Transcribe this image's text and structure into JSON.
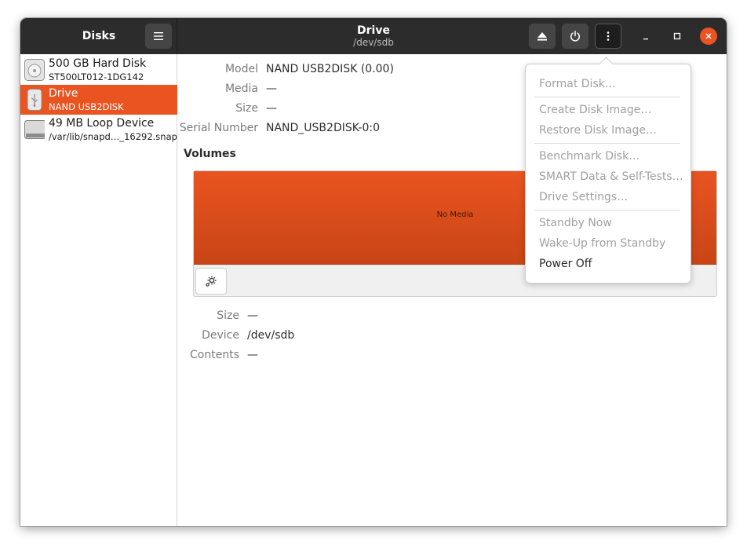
{
  "header": {
    "app_title": "Disks",
    "drive_title": "Drive",
    "drive_subtitle": "/dev/sdb",
    "icons": {
      "menu": "hamburger-icon",
      "eject": "eject-icon",
      "power": "power-icon",
      "more": "vertical-dots-icon",
      "minimize": "minimize-icon",
      "maximize": "maximize-icon",
      "close": "close-icon"
    }
  },
  "sidebar": {
    "items": [
      {
        "name": "500 GB Hard Disk",
        "subtitle": "ST500LT012-1DG142",
        "icon": "hard-disk-icon",
        "selected": false
      },
      {
        "name": "Drive",
        "subtitle": "NAND USB2DISK",
        "icon": "usb-drive-icon",
        "selected": true
      },
      {
        "name": "49 MB Loop Device",
        "subtitle": "/var/lib/snapd…_16292.snap",
        "icon": "loop-device-icon",
        "selected": false
      }
    ]
  },
  "drive_info": {
    "model_label": "Model",
    "model_value": "NAND USB2DISK (0.00)",
    "media_label": "Media",
    "media_value": "—",
    "size_label": "Size",
    "size_value": "—",
    "serial_label": "Serial Number",
    "serial_value": "NAND_USB2DISK-0:0"
  },
  "volumes": {
    "heading": "Volumes",
    "bar_text": "No Media",
    "gear_icon": "gear-icon",
    "size_label": "Size",
    "size_value": "—",
    "device_label": "Device",
    "device_value": "/dev/sdb",
    "contents_label": "Contents",
    "contents_value": "—"
  },
  "menu": {
    "items": [
      {
        "label": "Format Disk…",
        "enabled": false
      },
      {
        "label": "Create Disk Image…",
        "enabled": false
      },
      {
        "label": "Restore Disk Image…",
        "enabled": false
      },
      {
        "label": "Benchmark Disk…",
        "enabled": false
      },
      {
        "label": "SMART Data & Self-Tests…",
        "enabled": false
      },
      {
        "label": "Drive Settings…",
        "enabled": false
      },
      {
        "label": "Standby Now",
        "enabled": false
      },
      {
        "label": "Wake-Up from Standby",
        "enabled": false
      },
      {
        "label": "Power Off",
        "enabled": true
      }
    ]
  },
  "colors": {
    "accent": "#e95420",
    "headerbar": "#2c2c2c",
    "disabled_text": "#a0a0a0"
  }
}
